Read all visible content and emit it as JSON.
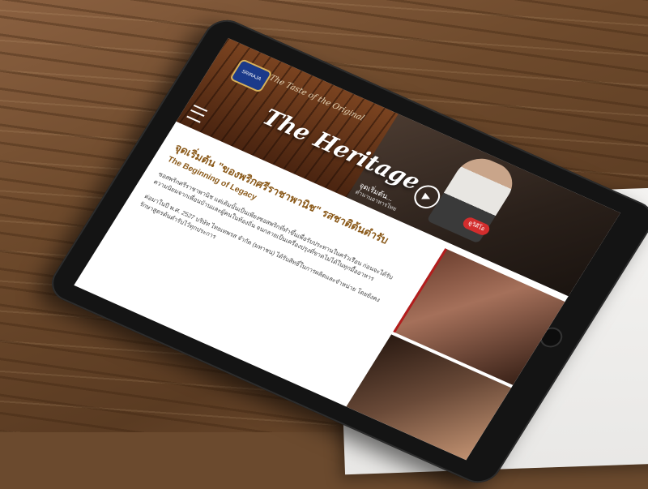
{
  "hero": {
    "tagline": "The Taste of the Original",
    "title": "The Heritage",
    "badge": "ดูวิดีโอ",
    "side_caption": "จุดเริ่มต้น...",
    "side_sub": "ตำนานอาหารไทย"
  },
  "article": {
    "heading_thai": "จุดเริ่มต้น \"ของพริกศรีราชาพานิช\" รสชาติต้นตำรับ",
    "heading_en": "The Beginning of Legacy",
    "para1": "ซอสพริกศรีราชาพานิช แต่เดิมนั้นเป็นเพียงซอสพริกที่ทำขึ้นเพื่อรับประทานในครัวเรือน ก่อนจะได้รับความนิยมจากเพื่อนบ้านและผู้คนในท้องถิ่น จนกลายเป็นเครื่องปรุงที่ขาดไม่ได้ในทุกมื้ออาหาร",
    "para2": "ต่อมาในปี พ.ศ. 2527 บริษัท ไทยเทพรส จำกัด (มหาชน) ได้รับสิทธิ์ในการผลิตและจำหน่าย โดยยังคงรักษาสูตรต้นตำรับไว้ทุกประการ"
  }
}
